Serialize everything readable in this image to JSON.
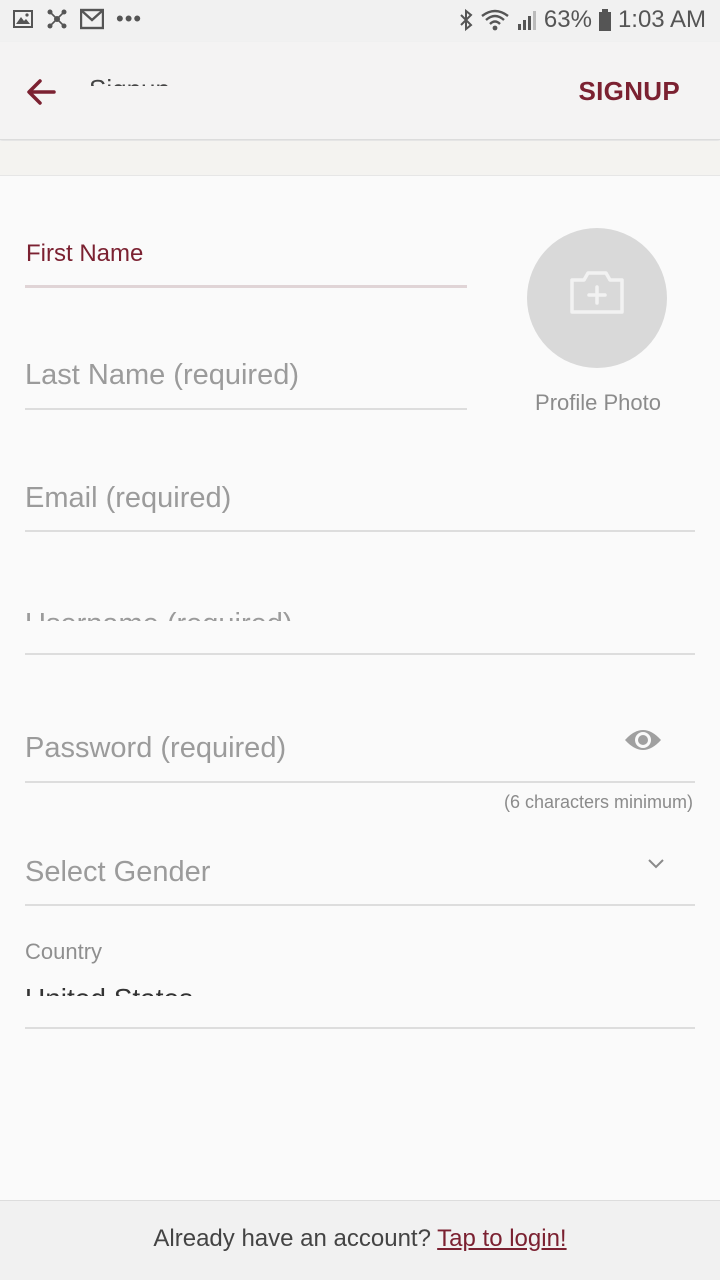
{
  "status_bar": {
    "battery": "63%",
    "time": "1:03 AM",
    "icons": [
      "image-icon",
      "network-icon",
      "gmail-icon",
      "more-dots-icon",
      "bluetooth-icon",
      "wifi-icon",
      "signal-icon",
      "battery-icon"
    ]
  },
  "app_bar": {
    "title": "Signup",
    "action_label": "SIGNUP",
    "accent_color": "#7b2131"
  },
  "form": {
    "first_name_label": "First Name",
    "last_name_placeholder": "Last Name (required)",
    "email_placeholder": "Email (required)",
    "username_placeholder": "Username (required)",
    "password_placeholder": "Password (required)",
    "password_hint": "(6 characters minimum)",
    "gender_placeholder": "Select Gender",
    "country_label": "Country",
    "country_value": "United States",
    "profile_photo_label": "Profile Photo"
  },
  "footer": {
    "prompt": "Already have an account? ",
    "link": "Tap to login!"
  }
}
